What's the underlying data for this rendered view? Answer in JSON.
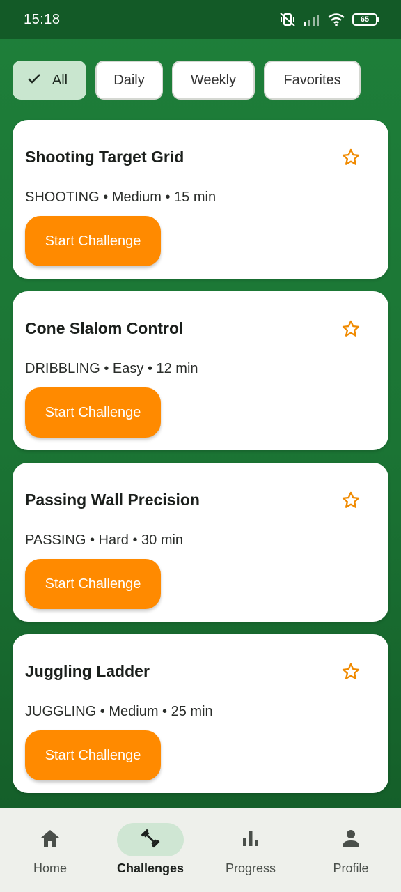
{
  "status_bar": {
    "time": "15:18",
    "battery_level": "65",
    "icons": [
      "mute-vibrate-icon",
      "signal-icon",
      "wifi-icon",
      "battery-icon"
    ]
  },
  "filters": {
    "items": [
      {
        "label": "All",
        "selected": true,
        "icon": "check-icon"
      },
      {
        "label": "Daily",
        "selected": false
      },
      {
        "label": "Weekly",
        "selected": false
      },
      {
        "label": "Favorites",
        "selected": false
      }
    ]
  },
  "challenges": [
    {
      "title": "Shooting Target Grid",
      "meta": "SHOOTING • Medium • 15 min",
      "button": "Start Challenge",
      "favorite_icon": "star-outline-icon"
    },
    {
      "title": "Cone Slalom Control",
      "meta": "DRIBBLING • Easy • 12 min",
      "button": "Start Challenge",
      "favorite_icon": "star-outline-icon"
    },
    {
      "title": "Passing Wall Precision",
      "meta": "PASSING • Hard • 30 min",
      "button": "Start Challenge",
      "favorite_icon": "star-outline-icon"
    },
    {
      "title": "Juggling Ladder",
      "meta": "JUGGLING • Medium • 25 min",
      "button": "Start Challenge",
      "favorite_icon": "star-outline-icon"
    }
  ],
  "bottom_nav": {
    "items": [
      {
        "label": "Home",
        "icon": "home-icon",
        "active": false
      },
      {
        "label": "Challenges",
        "icon": "dumbbell-icon",
        "active": true
      },
      {
        "label": "Progress",
        "icon": "bar-chart-icon",
        "active": false
      },
      {
        "label": "Profile",
        "icon": "person-icon",
        "active": false
      }
    ]
  },
  "colors": {
    "accent": "#ff8a00",
    "primary_green": "#1e7f3a",
    "selected_chip": "#c9e6cf",
    "star": "#f08a00"
  }
}
